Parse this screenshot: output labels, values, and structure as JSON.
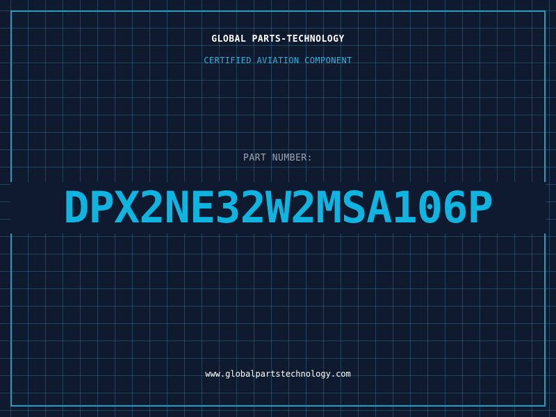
{
  "header": {
    "company_name": "GLOBAL PARTS-TECHNOLOGY",
    "tagline": "CERTIFIED AVIATION COMPONENT"
  },
  "part": {
    "label": "PART NUMBER:",
    "number": "DPX2NE32W2MSA106P"
  },
  "footer": {
    "url": "www.globalpartstechnology.com"
  },
  "colors": {
    "background": "#0f1a2e",
    "grid": "#387896",
    "frame": "#1e9ec9",
    "accent": "#0fb4e0",
    "label": "#9aa8ba",
    "text": "#ffffff"
  }
}
